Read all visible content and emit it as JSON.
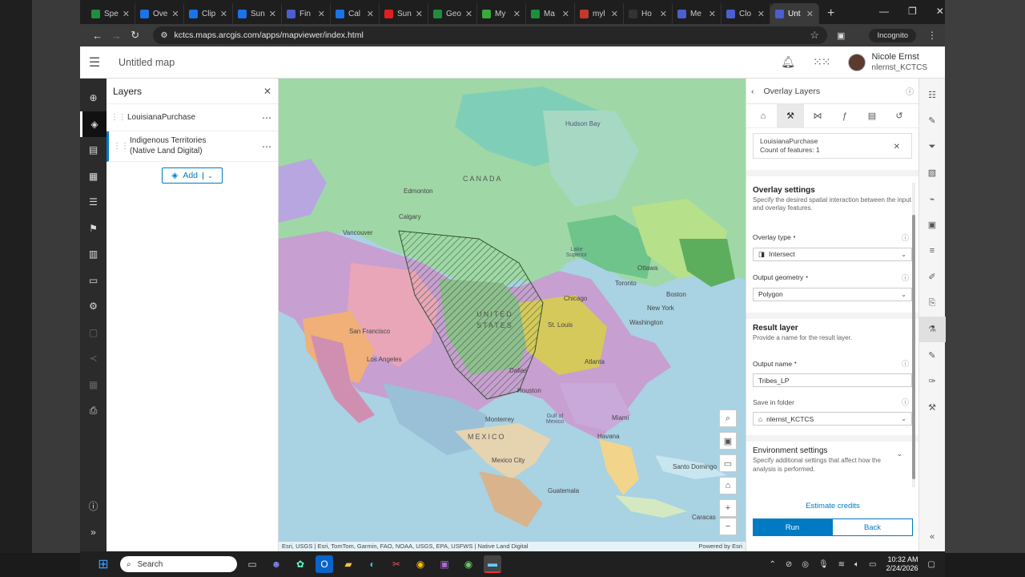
{
  "browser": {
    "tabs": [
      {
        "label": "Spe",
        "color": "#1e8e3e"
      },
      {
        "label": "Ove",
        "color": "#1a73e8"
      },
      {
        "label": "Clip",
        "color": "#1a73e8"
      },
      {
        "label": "Sun",
        "color": "#1a73e8"
      },
      {
        "label": "Fin",
        "color": "#4a5fd0"
      },
      {
        "label": "Cal",
        "color": "#1a73e8"
      },
      {
        "label": "Sun",
        "color": "#e02020"
      },
      {
        "label": "Geo",
        "color": "#1e8e3e"
      },
      {
        "label": "My",
        "color": "#39a939"
      },
      {
        "label": "Ma",
        "color": "#1e8e3e"
      },
      {
        "label": "myl",
        "color": "#c0392b"
      },
      {
        "label": "Ho",
        "color": "#333333"
      },
      {
        "label": "Me",
        "color": "#4a5fd0"
      },
      {
        "label": "Clo",
        "color": "#4a5fd0"
      },
      {
        "label": "Unt",
        "color": "#4a5fd0"
      }
    ],
    "new_tab": "+",
    "url": "kctcs.maps.arcgis.com/apps/mapviewer/index.html",
    "incognito_label": "Incognito"
  },
  "app": {
    "title": "Untitled map",
    "user": {
      "name": "Nicole Ernst",
      "id": "nlernst_KCTCS"
    }
  },
  "layers_panel": {
    "title": "Layers",
    "layers": [
      {
        "name": "LouisianaPurchase"
      },
      {
        "name": "Indigenous Territories (Native Land Digital)"
      }
    ],
    "add_label": "Add"
  },
  "map": {
    "labels": {
      "canada": "CANADA",
      "united_states": "UNITED STATES",
      "mexico": "MEXICO",
      "hudson_bay": "Hudson Bay",
      "edmonton": "Edmonton",
      "calgary": "Calgary",
      "vancouver": "Vancouver",
      "san_francisco": "San Francisco",
      "los_angeles": "Los Angeles",
      "chicago": "Chicago",
      "st_louis": "St. Louis",
      "toronto": "Toronto",
      "ottawa": "Ottawa",
      "boston": "Boston",
      "new_york": "New York",
      "washington": "Washington",
      "atlanta": "Atlanta",
      "houston": "Houston",
      "dallas": "Dallas",
      "miami": "Miami",
      "havana": "Havana",
      "monterrey": "Monterrey",
      "mexico_city": "Mexico City",
      "guatemala": "Guatemala",
      "santo_domingo": "Santo Domingo",
      "caracas": "Caracas",
      "gulf_of_mexico": "Gulf of Mexico",
      "lake_superior": "Lake Superior"
    },
    "attribution": "Esri, USGS | Esri, TomTom, Garmin, FAO, NOAA, USGS, EPA, USFWS | Native Land Digital",
    "powered_by": "Powered by Esri"
  },
  "overlay_panel": {
    "title": "Overlay Layers",
    "input_chip": {
      "name": "LouisianaPurchase",
      "count": "Count of features: 1"
    },
    "overlay_settings": {
      "title": "Overlay settings",
      "description": "Specify the desired spatial interaction between the input and overlay features.",
      "overlay_type_label": "Overlay type",
      "overlay_type_value": "Intersect",
      "output_geometry_label": "Output geometry",
      "output_geometry_value": "Polygon"
    },
    "result_layer": {
      "title": "Result layer",
      "description": "Provide a name for the result layer.",
      "output_name_label": "Output name",
      "output_name_value": "Tribes_LP",
      "save_folder_label": "Save in folder",
      "save_folder_value": "nlernst_KCTCS"
    },
    "environment": {
      "title": "Environment settings",
      "description": "Specify additional settings that affect how the analysis is performed."
    },
    "estimate_label": "Estimate credits",
    "run_label": "Run",
    "back_label": "Back"
  },
  "taskbar": {
    "search_label": "Search",
    "time": "10:32 AM",
    "date": "2/24/2026"
  }
}
